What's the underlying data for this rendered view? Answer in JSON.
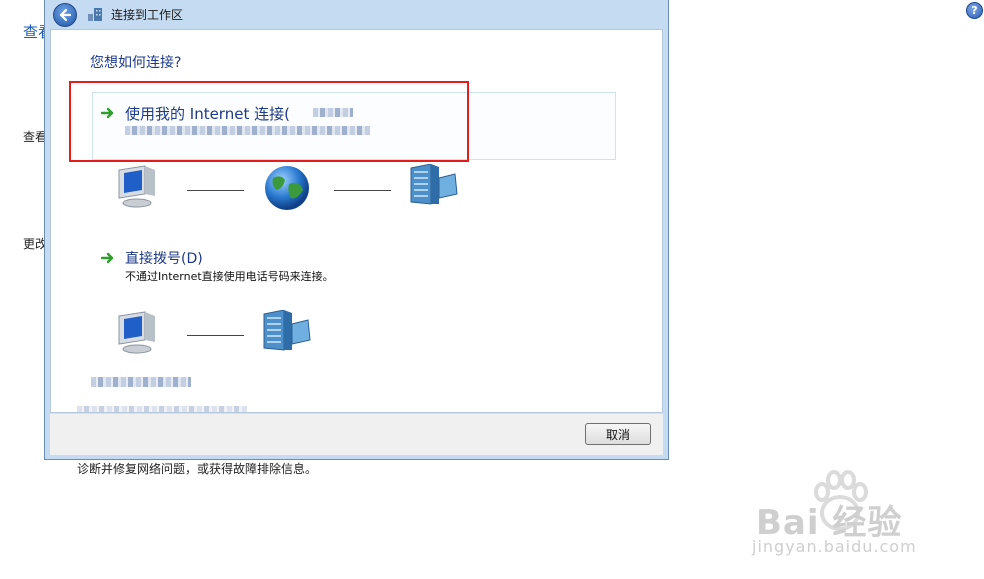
{
  "background": {
    "link_fragment": "查看",
    "text_fragment_1": "查看",
    "text_fragment_2": "更改",
    "bottom_text": "诊断并修复网络问题，或获得故障排除信息。",
    "help_label": "?"
  },
  "dialog": {
    "title": "连接到工作区",
    "question": "您想如何连接?",
    "option_internet": {
      "title": "使用我的 Internet 连接(",
      "description": ""
    },
    "option_dialup": {
      "title": "直接拨号(D)",
      "description": "不通过Internet直接使用电话号码来连接。"
    },
    "cancel_label": "取消"
  },
  "watermark": {
    "brand": "Bai  经验",
    "url": "jingyan.baidu.com"
  },
  "icons": [
    "back-arrow-icon",
    "workplace-icon",
    "green-arrow-icon",
    "computer-icon",
    "globe-icon",
    "building-icon",
    "help-icon",
    "paw-icon"
  ]
}
